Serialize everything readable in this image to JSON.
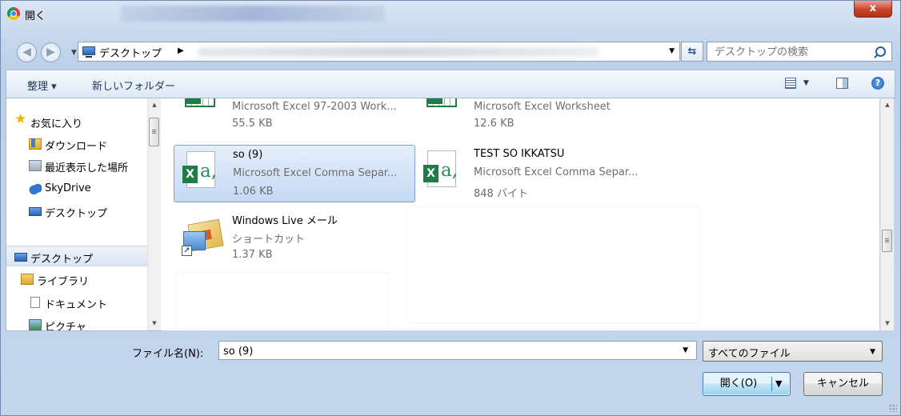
{
  "window": {
    "title": "開く",
    "close_label": "x"
  },
  "address_bar": {
    "path": "デスクトップ",
    "search_placeholder": "デスクトップの検索"
  },
  "toolbar": {
    "organize": "整理 ▾",
    "new_folder": "新しいフォルダー"
  },
  "nav": {
    "items": [
      {
        "label": "お気に入り"
      },
      {
        "label": "ダウンロード"
      },
      {
        "label": "最近表示した場所"
      },
      {
        "label": "SkyDrive"
      },
      {
        "label": "デスクトップ"
      },
      {
        "label": "デスクトップ"
      },
      {
        "label": "ライブラリ"
      },
      {
        "label": "ドキュメント"
      },
      {
        "label": "ピクチャ"
      }
    ]
  },
  "files": [
    {
      "name": "",
      "type": "Microsoft Excel 97-2003 Work...",
      "size": "55.5 KB"
    },
    {
      "name": "",
      "type": "Microsoft Excel Worksheet",
      "size": "12.6 KB"
    },
    {
      "name": "so (9)",
      "type": "Microsoft Excel Comma Separ...",
      "size": "1.06 KB"
    },
    {
      "name": "TEST SO IKKATSU",
      "type": "Microsoft Excel Comma Separ...",
      "size": "848 バイト"
    },
    {
      "name": "Windows Live メール",
      "type": "ショートカット",
      "size": "1.37 KB"
    }
  ],
  "bottom": {
    "filename_label": "ファイル名(N):",
    "filename_value": "so (9)",
    "filter_value": "すべてのファイル",
    "open_label": "開く(O)",
    "cancel_label": "キャンセル"
  },
  "icons": {
    "excel_green": "#1f7c45",
    "selection_blue": "#c5d9f4"
  }
}
